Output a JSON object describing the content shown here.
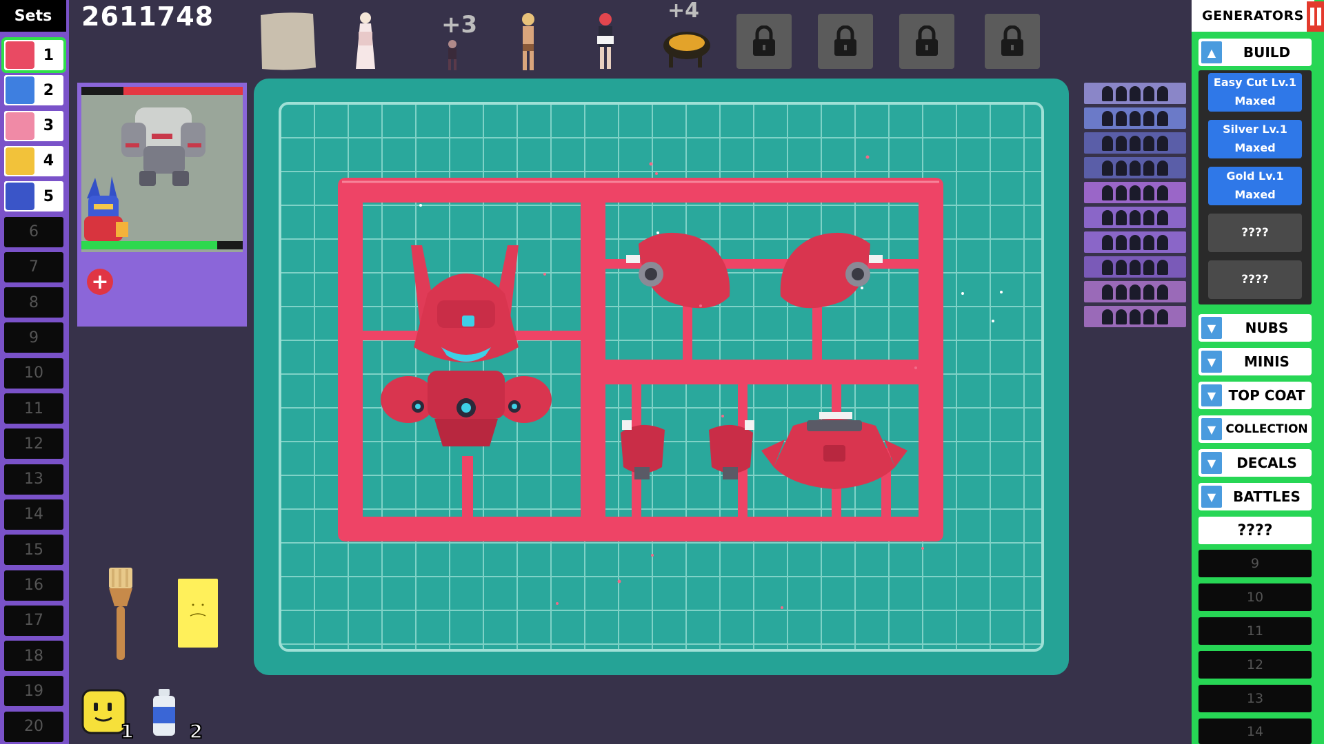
{
  "sets_panel": {
    "title": "Sets",
    "items": [
      {
        "num": "1",
        "filled": true,
        "active": true,
        "thumb_color": "#e94a63"
      },
      {
        "num": "2",
        "filled": true,
        "thumb_color": "#3e7fe0"
      },
      {
        "num": "3",
        "filled": true,
        "thumb_color": "#f08aa6"
      },
      {
        "num": "4",
        "filled": true,
        "thumb_color": "#f2c23a"
      },
      {
        "num": "5",
        "filled": true,
        "thumb_color": "#3a55c8"
      },
      {
        "num": "6"
      },
      {
        "num": "7"
      },
      {
        "num": "8"
      },
      {
        "num": "9"
      },
      {
        "num": "10"
      },
      {
        "num": "11"
      },
      {
        "num": "12"
      },
      {
        "num": "13"
      },
      {
        "num": "14"
      },
      {
        "num": "15"
      },
      {
        "num": "16"
      },
      {
        "num": "17"
      },
      {
        "num": "18"
      },
      {
        "num": "19"
      },
      {
        "num": "20"
      }
    ]
  },
  "score": "2611748",
  "preview": {
    "enemy_health": 0.74,
    "player_health": 0.84
  },
  "top_row": {
    "extra_counts": [
      "+3",
      "+4"
    ],
    "locked_slots": 4
  },
  "gallery_rows": 10,
  "generators": {
    "title": "GENERATORS",
    "build_label": "BUILD",
    "upgrades": [
      {
        "line1": "Easy Cut Lv.1",
        "line2": "Maxed"
      },
      {
        "line1": "Silver Lv.1",
        "line2": "Maxed"
      },
      {
        "line1": "Gold Lv.1",
        "line2": "Maxed"
      }
    ],
    "locked_upgrades": [
      "????",
      "????"
    ],
    "sections": [
      "NUBS",
      "MINIS",
      "TOP COAT",
      "COLLECTION",
      "DECALS",
      "BATTLES"
    ],
    "unknown": "????",
    "empty_slots": [
      "9",
      "10",
      "11",
      "12",
      "13",
      "14"
    ]
  },
  "inventory": {
    "sponge_count": "1",
    "paint_count": "2"
  },
  "colors": {
    "mat": "#25a396",
    "sprue": "#ee4466",
    "generators_bg": "#27d655",
    "sets_bg": "#7a52c9"
  }
}
